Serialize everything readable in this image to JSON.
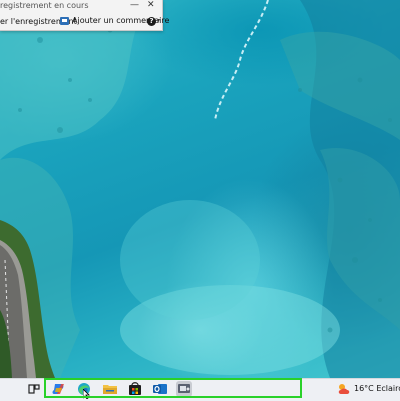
{
  "recorder": {
    "title": "registrement en cours",
    "minimize": "—",
    "close": "✕",
    "stop_label": "er l'enregistrement",
    "comment_label": "Ajouter un commentaire",
    "help_glyph": "?",
    "help_caret": "▾",
    "icons": [
      "comment-icon",
      "help-icon"
    ]
  },
  "taskbar": {
    "apps": [
      {
        "name": "task-view",
        "icon": "task-view-icon"
      },
      {
        "name": "copilot",
        "icon": "copilot-icon"
      },
      {
        "name": "edge",
        "icon": "edge-icon"
      },
      {
        "name": "file-explorer",
        "icon": "folder-icon"
      },
      {
        "name": "microsoft-store",
        "icon": "store-icon"
      },
      {
        "name": "outlook",
        "icon": "outlook-icon"
      },
      {
        "name": "steps-recorder",
        "icon": "recorder-icon",
        "active": true
      }
    ],
    "weather": {
      "temperature": "16°C",
      "condition": "Eclaircie",
      "icon": "partly-cloudy-icon"
    }
  },
  "colors": {
    "highlight": "#29d129",
    "taskbar_bg": "#eef0f4",
    "lagoon": "#1aa3bd"
  }
}
